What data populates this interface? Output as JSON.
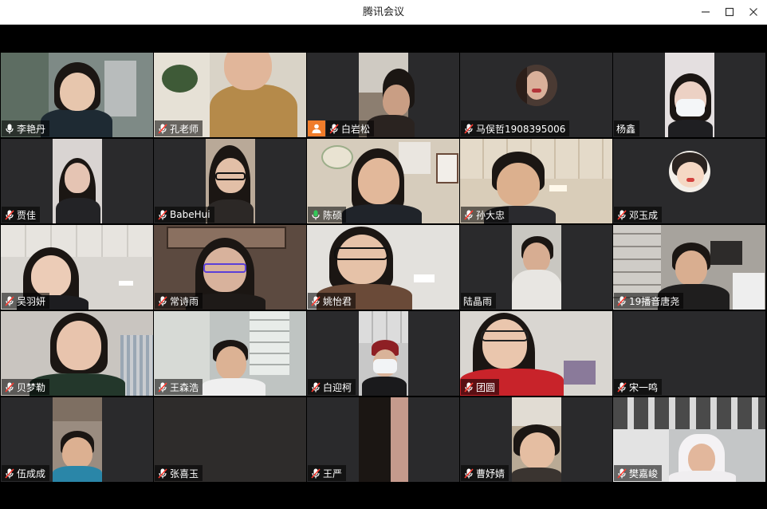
{
  "window": {
    "title": "腾讯会议",
    "minimize_icon": "minimize-icon",
    "maximize_icon": "maximize-icon",
    "close_icon": "close-icon"
  },
  "colors": {
    "mic_active": "#34c759",
    "mic_muted": "#ffffff",
    "muted_slash": "#ff3b30",
    "badge_orange": "#f07c2a",
    "tile_bg": "#2a2a2c"
  },
  "participants": [
    {
      "name": "李艳丹",
      "mic": "on-white"
    },
    {
      "name": "孔老师",
      "mic": "muted"
    },
    {
      "name": "白岩松",
      "mic": "muted",
      "badge": "user-icon"
    },
    {
      "name": "马俣哲1908395006",
      "mic": "muted",
      "avatar": true
    },
    {
      "name": "杨鑫",
      "mic": "none"
    },
    {
      "name": "贾佳",
      "mic": "muted"
    },
    {
      "name": "BabeHui",
      "mic": "muted"
    },
    {
      "name": "陈硕",
      "mic": "active"
    },
    {
      "name": "孙大忠",
      "mic": "muted"
    },
    {
      "name": "邓玉成",
      "mic": "muted",
      "avatar": true
    },
    {
      "name": "吴羽妍",
      "mic": "muted"
    },
    {
      "name": "常诗雨",
      "mic": "muted"
    },
    {
      "name": "姚怡君",
      "mic": "muted"
    },
    {
      "name": "陆晶雨",
      "mic": "none"
    },
    {
      "name": "19播音唐尧",
      "mic": "muted"
    },
    {
      "name": "贝梦勒",
      "mic": "muted"
    },
    {
      "name": "王森浩",
      "mic": "muted"
    },
    {
      "name": "白迎柯",
      "mic": "muted"
    },
    {
      "name": "团圆",
      "mic": "muted"
    },
    {
      "name": "宋一鸣",
      "mic": "muted"
    },
    {
      "name": "伍成成",
      "mic": "muted"
    },
    {
      "name": "张喜玉",
      "mic": "muted"
    },
    {
      "name": "王严",
      "mic": "muted"
    },
    {
      "name": "曹妤婧",
      "mic": "muted"
    },
    {
      "name": "樊嘉峻",
      "mic": "muted"
    }
  ]
}
